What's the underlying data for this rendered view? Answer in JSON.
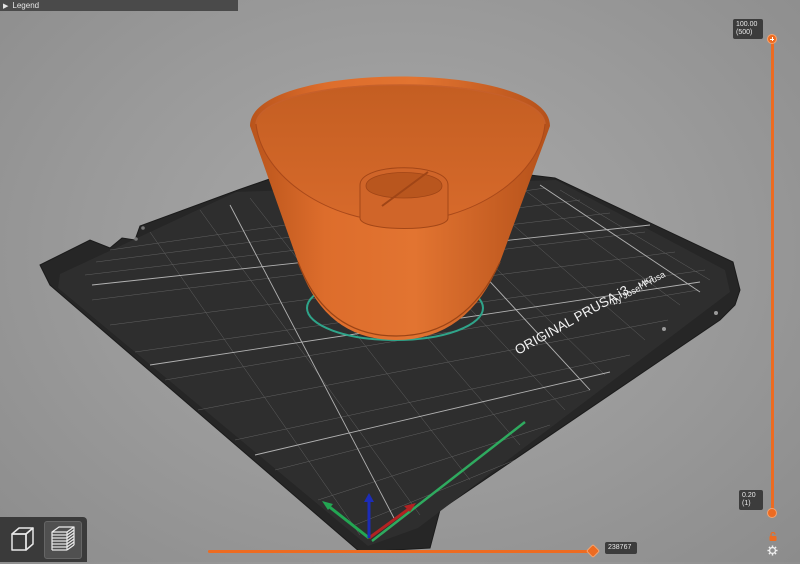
{
  "legend": {
    "label": "Legend"
  },
  "vertical_slider": {
    "top_value": "100.00",
    "top_layer": "(500)",
    "bottom_value": "0.20",
    "bottom_layer": "(1)"
  },
  "horizontal_slider": {
    "value": "238767"
  },
  "bed": {
    "brand_text": "ORIGINAL PRUSA i3",
    "model_text": "MK3",
    "maker_text": "by Josef Prusa"
  },
  "colors": {
    "accent": "#ed6b21",
    "model": "#d9692a",
    "bed": "#2b2b2b",
    "background": "#9e9e9e"
  },
  "icons": {
    "legend_toggle": "triangle-right-icon",
    "lock": "lock-icon",
    "settings": "gear-icon",
    "view_3d": "cube-icon",
    "view_preview": "layers-icon"
  }
}
